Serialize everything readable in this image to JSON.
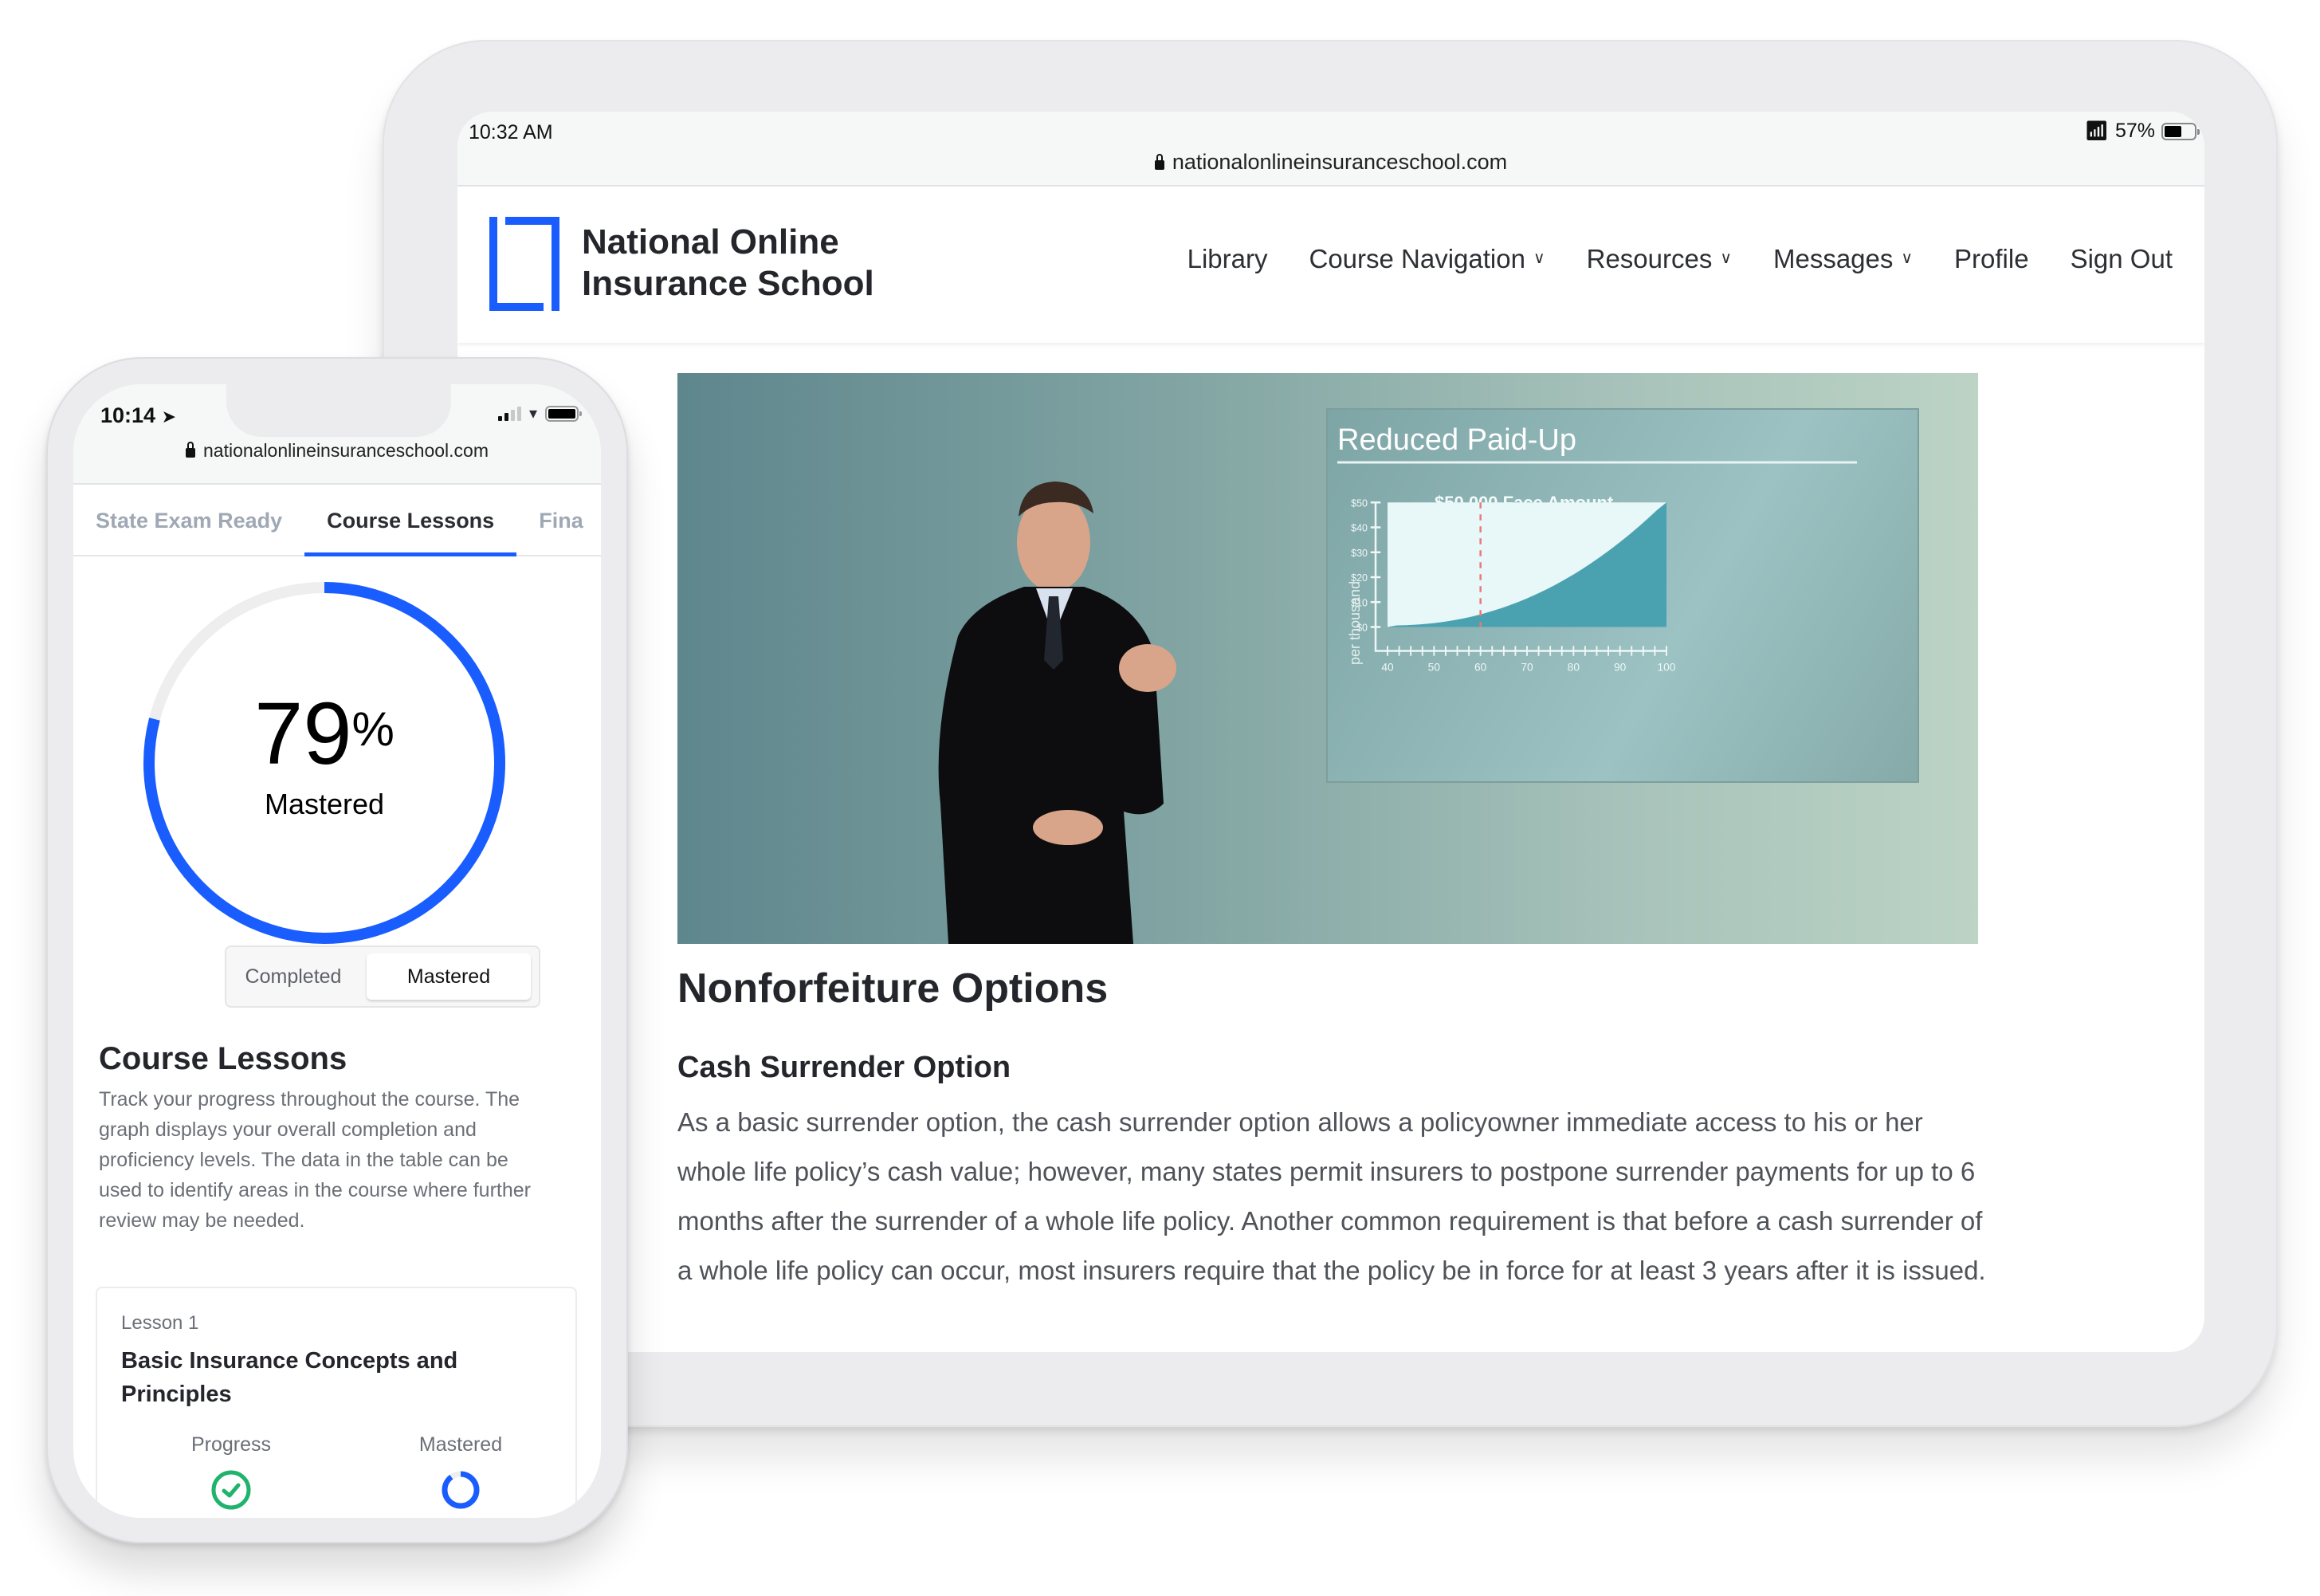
{
  "tablet": {
    "status": {
      "time": "10:32 AM",
      "battery_text": "57%",
      "battery_level": 0.57,
      "wifi_icon": "wifi-icon",
      "battery_icon": "battery-icon"
    },
    "url": "nationalonlineinsuranceschool.com",
    "brand": {
      "name_line1": "National Online",
      "name_line2": "Insurance School",
      "accent": "#1a5dff"
    },
    "nav": [
      {
        "label": "Library",
        "dropdown": false
      },
      {
        "label": "Course Navigation",
        "dropdown": true
      },
      {
        "label": "Resources",
        "dropdown": true
      },
      {
        "label": "Messages",
        "dropdown": true
      },
      {
        "label": "Profile",
        "dropdown": false
      },
      {
        "label": "Sign Out",
        "dropdown": false
      }
    ],
    "video": {
      "chart_title": "Reduced Paid-Up",
      "chart_subtitle": "$50,000 Face Amount",
      "y_axis_label": "per thousand",
      "y_ticks": [
        "$0",
        "$10",
        "$20",
        "$30",
        "$40",
        "$50"
      ],
      "x_ticks": [
        "40",
        "50",
        "60",
        "70",
        "80",
        "90",
        "100"
      ],
      "marker_age": 60
    },
    "article": {
      "title": "Nonforfeiture Options",
      "subtitle": "Cash Surrender Option",
      "body": "As a basic surrender option, the cash surrender option allows a policyowner immediate access to his or her whole life policy’s cash value; however, many states permit insurers to postpone surrender payments for up to 6 months after the surrender of a whole life policy.  Another common requirement is that before a cash surrender of a whole life policy can occur, most insurers require that the policy be in force for at least 3 years after it is issued."
    }
  },
  "phone": {
    "status": {
      "time": "10:14",
      "location_icon": "location-arrow-icon",
      "signal_icon": "signal-icon",
      "wifi_icon": "wifi-icon",
      "battery_icon": "battery-icon"
    },
    "url": "nationalonlineinsuranceschool.com",
    "tabs": [
      {
        "label": "State Exam Ready",
        "active": false
      },
      {
        "label": "Course Lessons",
        "active": true
      },
      {
        "label": "Fina",
        "active": false
      }
    ],
    "gauge": {
      "value": 79,
      "percent_sign": "%",
      "label": "Mastered",
      "color": "#1a5dff",
      "track": "#eeeeee"
    },
    "toggle": {
      "options": [
        "Completed",
        "Mastered"
      ],
      "selected": "Mastered"
    },
    "section": {
      "title": "Course Lessons",
      "description": "Track your progress throughout the course. The graph displays your overall completion and proficiency levels. The data in the table can be used to identify areas in the course where further review may be needed."
    },
    "lesson": {
      "number": "Lesson 1",
      "title": "Basic Insurance Concepts and Principles",
      "progress_label": "Progress",
      "progress_status": "complete",
      "progress_color": "#1fb36b",
      "mastered_label": "Mastered",
      "mastered_fraction": 0.9
    }
  }
}
